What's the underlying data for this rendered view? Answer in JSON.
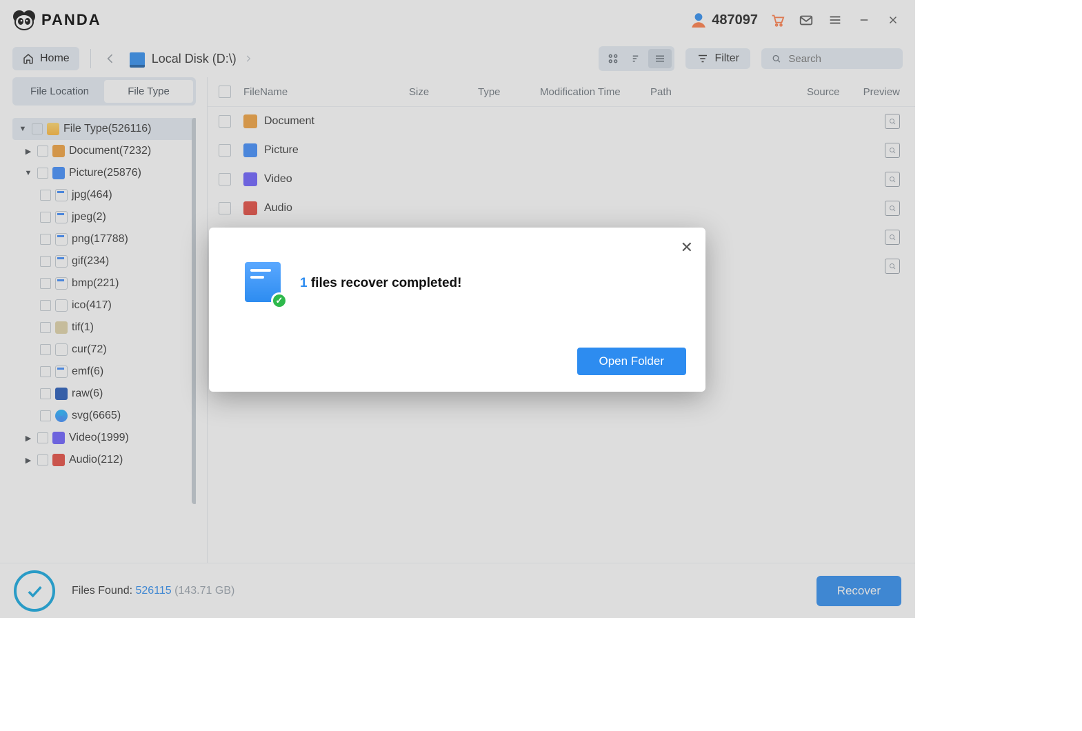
{
  "brand": "PANDA",
  "user_id": "487097",
  "home_label": "Home",
  "breadcrumb": "Local Disk (D:\\)",
  "filter_label": "Filter",
  "search_placeholder": "Search",
  "sidebar_tabs": {
    "location": "File Location",
    "type": "File Type"
  },
  "tree": {
    "root": "File Type(526116)",
    "document": "Document(7232)",
    "picture": "Picture(25876)",
    "jpg": "jpg(464)",
    "jpeg": "jpeg(2)",
    "png": "png(17788)",
    "gif": "gif(234)",
    "bmp": "bmp(221)",
    "ico": "ico(417)",
    "tif": "tif(1)",
    "cur": "cur(72)",
    "emf": "emf(6)",
    "raw": "raw(6)",
    "svg": "svg(6665)",
    "video": "Video(1999)",
    "audio": "Audio(212)"
  },
  "columns": {
    "name": "FileName",
    "size": "Size",
    "type": "Type",
    "mod": "Modification Time",
    "path": "Path",
    "src": "Source",
    "prev": "Preview"
  },
  "rows": [
    {
      "label": "Document",
      "kind": "doc"
    },
    {
      "label": "Picture",
      "kind": "pic"
    },
    {
      "label": "Video",
      "kind": "vid"
    },
    {
      "label": "Audio",
      "kind": "aud"
    }
  ],
  "footer": {
    "label": "Files Found:",
    "count": "526115",
    "size": "(143.71 GB)",
    "recover": "Recover"
  },
  "modal": {
    "count": "1",
    "message": "files recover completed!",
    "button": "Open Folder"
  }
}
